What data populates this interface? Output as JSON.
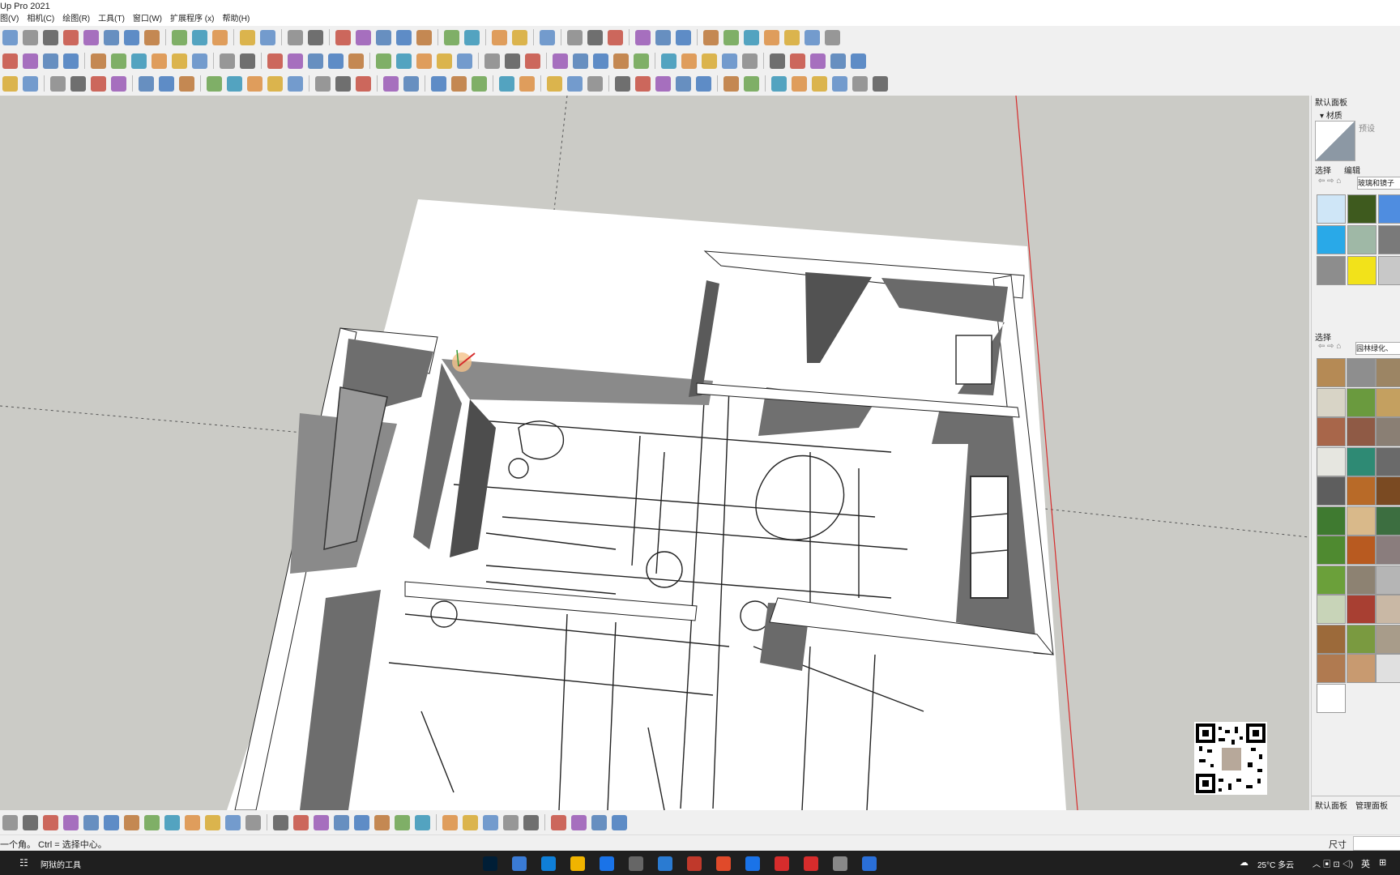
{
  "app": {
    "title": "Up Pro 2021"
  },
  "menu": {
    "items": [
      "图(V)",
      "相机(C)",
      "绘图(R)",
      "工具(T)",
      "窗口(W)",
      "扩展程序 (x)",
      "帮助(H)"
    ]
  },
  "status": {
    "hint": "一个角。 Ctrl = 选择中心。",
    "measure_label": "尺寸"
  },
  "panel": {
    "title": "默认面板",
    "section_materials": "材质",
    "preset_label": "预设",
    "tab_select": "选择",
    "tab_edit": "编辑",
    "collection1": "玻璃和镜子",
    "section_select": "选择",
    "collection2": "园林绿化、",
    "bottom_tab_default": "默认面板",
    "bottom_tab_manage": "管理面板"
  },
  "taskbar": {
    "start_label": "阿狱的工具",
    "weather": "25°C 多云",
    "lang": "英"
  },
  "colors": {
    "viewport_bg": "#cbcbc6",
    "wall_dark": "#555555",
    "wall_mid": "#7a7a7a",
    "red_axis": "#d62c2c"
  }
}
